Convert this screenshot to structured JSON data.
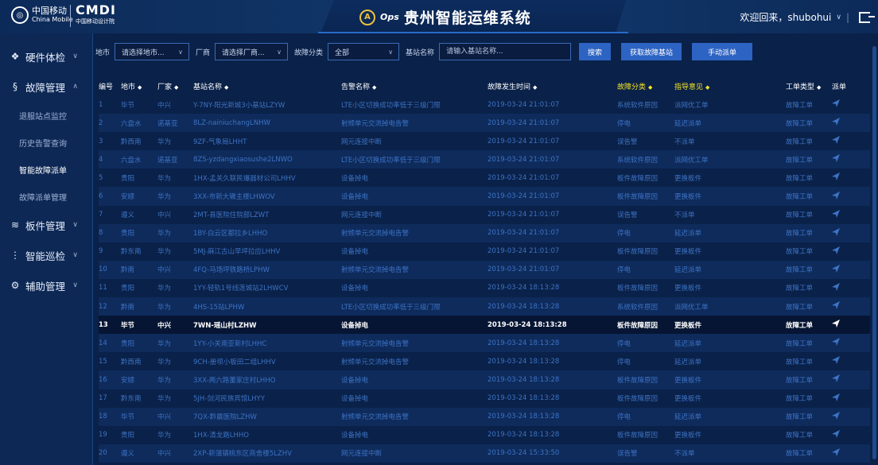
{
  "header": {
    "cm_mark": "◎",
    "cm_cn": "中国移动",
    "cm_en": "China Mobile",
    "cmdi_big": "CMDI",
    "cmdi_small": "中国移动设计院",
    "aops_label": "Ops",
    "title": "贵州智能运维系统",
    "welcome": "欢迎回来，",
    "username": "shubohui"
  },
  "sidebar": {
    "groups": [
      {
        "label": "硬件体检",
        "icon": "hardware-icon"
      },
      {
        "label": "故障管理",
        "icon": "fault-icon"
      },
      {
        "label": "板件管理",
        "icon": "board-icon"
      },
      {
        "label": "智能巡检",
        "icon": "inspect-icon"
      },
      {
        "label": "辅助管理",
        "icon": "assist-icon"
      }
    ],
    "sub_items": [
      "退服站点监控",
      "历史告警查询",
      "智能故障派单",
      "故障派单管理"
    ],
    "active_sub": "智能故障派单"
  },
  "filters": {
    "city_label": "地市",
    "city_placeholder": "请选择地市...",
    "vendor_label": "厂商",
    "vendor_placeholder": "请选择厂商...",
    "category_label": "故障分类",
    "category_value": "全部",
    "station_label": "基站名称",
    "station_placeholder": "请输入基站名称...",
    "search_btn": "搜索",
    "get_btn": "获取故障基站",
    "dispatch_btn": "手动派单"
  },
  "table": {
    "headers": [
      "编号",
      "地市",
      "厂家",
      "基站名称",
      "告警名称",
      "故障发生时间",
      "故障分类",
      "指导意见",
      "工单类型",
      "派单"
    ],
    "rows": [
      [
        "1",
        "毕节",
        "中兴",
        "Y-7NY-阳光新城3小基站LZYW",
        "LTE小区切换成功率低于三级门限",
        "2019-03-24 21:01:07",
        "系统软件原因",
        "派网优工单",
        "故障工单"
      ],
      [
        "2",
        "六盘水",
        "诺基亚",
        "8LZ-nainiuchangLNHW",
        "射频单元交流掉电告警",
        "2019-03-24 21:01:07",
        "停电",
        "延迟派单",
        "故障工单"
      ],
      [
        "3",
        "黔西南",
        "华为",
        "9ZF-气象局LHHT",
        "网元连接中断",
        "2019-03-24 21:01:07",
        "误告警",
        "不派单",
        "故障工单"
      ],
      [
        "4",
        "六盘水",
        "诺基亚",
        "8ZS-yzdangxiaosushe2LNWO",
        "LTE小区切换成功率低于三级门限",
        "2019-03-24 21:01:07",
        "系统软件原因",
        "派网优工单",
        "故障工单"
      ],
      [
        "5",
        "贵阳",
        "华为",
        "1HX-孟关久联民爆器材公司LHHV",
        "设备掉电",
        "2019-03-24 21:01:07",
        "板件故障原因",
        "更换板件",
        "故障工单"
      ],
      [
        "6",
        "安顺",
        "华为",
        "3XX-市新大辙主楼LHWOV",
        "设备掉电",
        "2019-03-24 21:01:07",
        "板件故障原因",
        "更换板件",
        "故障工单"
      ],
      [
        "7",
        "遵义",
        "中兴",
        "2MT-县医院住院部LZWT",
        "网元连接中断",
        "2019-03-24 21:01:07",
        "误告警",
        "不派单",
        "故障工单"
      ],
      [
        "8",
        "贵阳",
        "华为",
        "1BY-白云区都拉乡LHHO",
        "射频单元交流掉电告警",
        "2019-03-24 21:01:07",
        "停电",
        "延迟派单",
        "故障工单"
      ],
      [
        "9",
        "黔东南",
        "华为",
        "5MJ-麻江古山早坪拉应LHHV",
        "设备掉电",
        "2019-03-24 21:01:07",
        "板件故障原因",
        "更换板件",
        "故障工单"
      ],
      [
        "10",
        "黔南",
        "中兴",
        "4FQ-马场坪铁路桥LPHW",
        "射频单元交流掉电告警",
        "2019-03-24 21:01:07",
        "停电",
        "延迟派单",
        "故障工单"
      ],
      [
        "11",
        "贵阳",
        "华为",
        "1YY-轻轨1号线莲城站2LHWCV",
        "设备掉电",
        "2019-03-24 18:13:28",
        "板件故障原因",
        "更换板件",
        "故障工单"
      ],
      [
        "12",
        "黔南",
        "华为",
        "4HS-15站LPHW",
        "LTE小区切换成功率低于三级门限",
        "2019-03-24 18:13:28",
        "系统软件原因",
        "派网优工单",
        "故障工单"
      ],
      [
        "13",
        "毕节",
        "中兴",
        "7WN-瑶山村LZHW",
        "设备掉电",
        "2019-03-24 18:13:28",
        "板件故障原因",
        "更换板件",
        "故障工单"
      ],
      [
        "14",
        "贵阳",
        "华为",
        "1YY-小关南亚新村LHHC",
        "射频单元交流掉电告警",
        "2019-03-24 18:13:28",
        "停电",
        "延迟派单",
        "故障工单"
      ],
      [
        "15",
        "黔西南",
        "华为",
        "9CH-册坝小板田二组LHHV",
        "射频单元交流掉电告警",
        "2019-03-24 18:13:28",
        "停电",
        "延迟派单",
        "故障工单"
      ],
      [
        "16",
        "安顺",
        "华为",
        "3XX-两六路董家庄村LHHO",
        "设备掉电",
        "2019-03-24 18:13:28",
        "板件故障原因",
        "更换板件",
        "故障工单"
      ],
      [
        "17",
        "黔东南",
        "华为",
        "5JH-剑河民族宾馆LHYY",
        "设备掉电",
        "2019-03-24 18:13:28",
        "板件故障原因",
        "更换板件",
        "故障工单"
      ],
      [
        "18",
        "毕节",
        "中兴",
        "7QX-黔晨医院LZHW",
        "射频单元交流掉电告警",
        "2019-03-24 18:13:28",
        "停电",
        "延迟派单",
        "故障工单"
      ],
      [
        "19",
        "贵阳",
        "华为",
        "1HX-清龙路LHHO",
        "设备掉电",
        "2019-03-24 18:13:28",
        "板件故障原因",
        "更换板件",
        "故障工单"
      ],
      [
        "20",
        "遵义",
        "中兴",
        "2XP-新蒲镇桃东区商舍楼5LZHV",
        "网元连接中断",
        "2019-03-24 15:33:50",
        "误告警",
        "不派单",
        "故障工单"
      ]
    ],
    "selected_row": 12,
    "sort_icon": "◆",
    "send_icon": "send-icon"
  },
  "colors": {
    "accent": "#2d63c2",
    "header_highlight": "#f5e625",
    "row_text": "#3d73c4",
    "background": "#0a2149"
  }
}
